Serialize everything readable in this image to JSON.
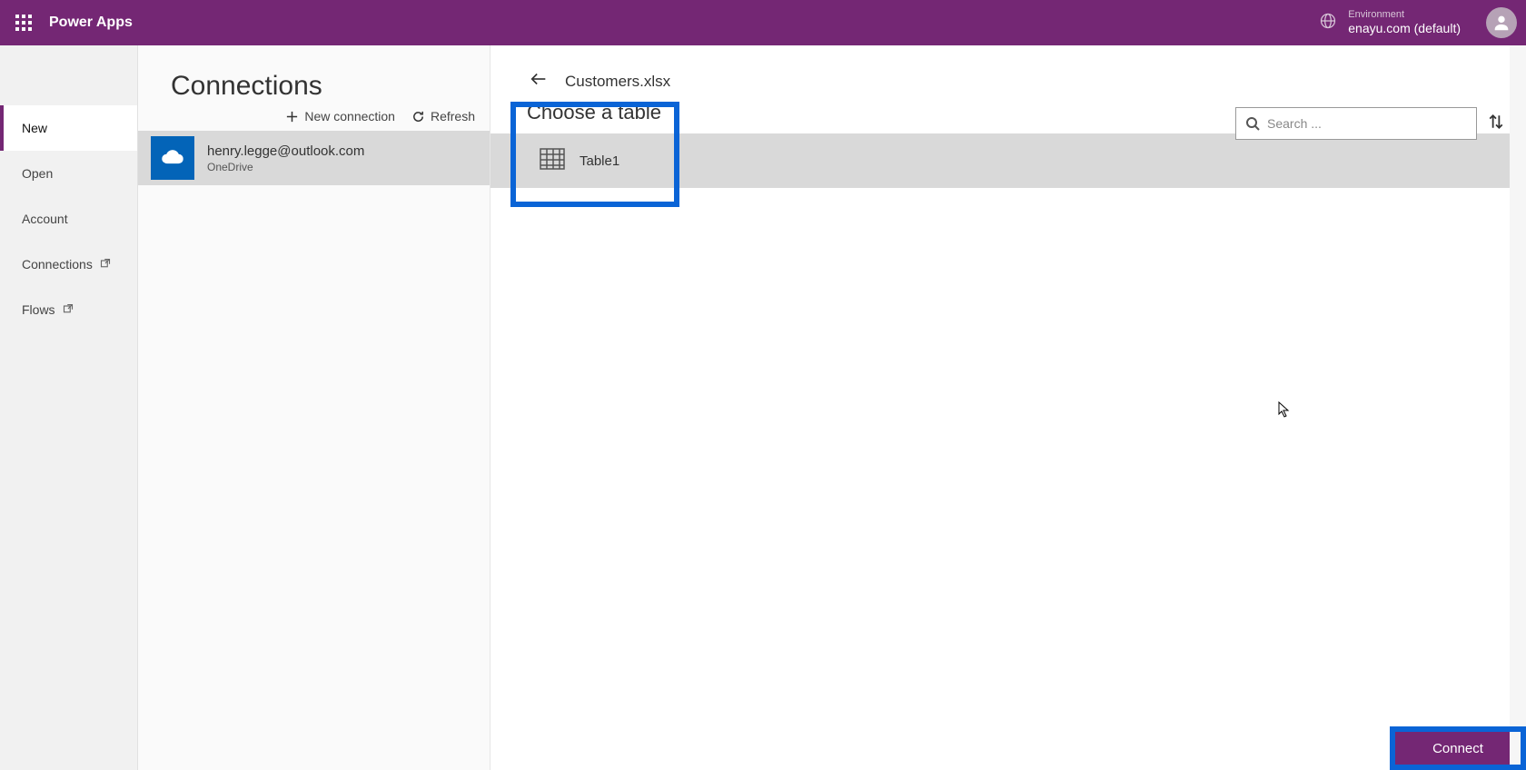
{
  "header": {
    "brand": "Power Apps",
    "environment_label": "Environment",
    "environment_name": "enayu.com (default)"
  },
  "sidebar": {
    "items": [
      {
        "label": "New",
        "external": false,
        "active": true
      },
      {
        "label": "Open",
        "external": false,
        "active": false
      },
      {
        "label": "Account",
        "external": false,
        "active": false
      },
      {
        "label": "Connections",
        "external": true,
        "active": false
      },
      {
        "label": "Flows",
        "external": true,
        "active": false
      }
    ]
  },
  "connections_panel": {
    "title": "Connections",
    "new_connection_label": "New connection",
    "refresh_label": "Refresh",
    "items": [
      {
        "title": "henry.legge@outlook.com",
        "subtitle": "OneDrive"
      }
    ]
  },
  "detail_panel": {
    "breadcrumb_file": "Customers.xlsx",
    "choose_title": "Choose a table",
    "search_placeholder": "Search ...",
    "tables": [
      {
        "name": "Table1"
      }
    ],
    "connect_label": "Connect"
  }
}
